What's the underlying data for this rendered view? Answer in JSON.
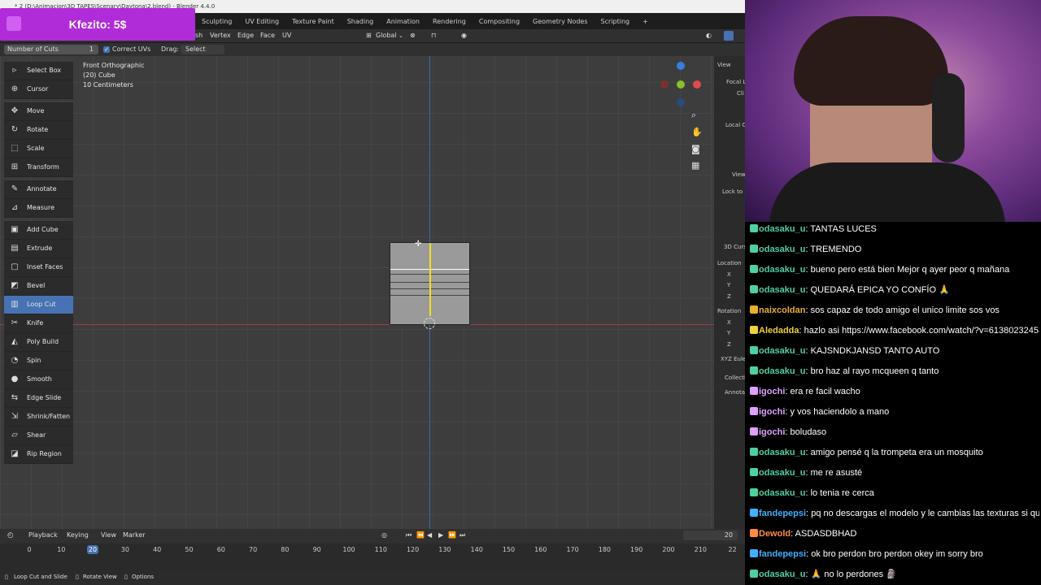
{
  "window": {
    "title": "* 2 (D:\\Animacion\\3D TAPES\\Scenary\\Daytona\\2.blend) - Blender 4.4.0"
  },
  "donation": {
    "text": "Kfezito: 5$"
  },
  "workspace_tabs": [
    "Sculpting",
    "UV Editing",
    "Texture Paint",
    "Shading",
    "Animation",
    "Rendering",
    "Compositing",
    "Geometry Nodes",
    "Scripting",
    "+"
  ],
  "header": {
    "menus": [
      "sh",
      "Vertex",
      "Edge",
      "Face",
      "UV"
    ],
    "orientation": "Global"
  },
  "tool_settings": {
    "cuts_label": "Number of Cuts",
    "cuts_value": "1",
    "correct_uvs_label": "Correct UVs",
    "drag_label": "Drag:",
    "drag_value": "Select Box"
  },
  "viewport_info": {
    "line1": "Front Orthographic",
    "line2": "(20) Cube",
    "line3": "10 Centimeters"
  },
  "tools": [
    {
      "label": "Select Box",
      "icon": "select-box-icon",
      "glyph": "▹"
    },
    {
      "label": "Cursor",
      "icon": "cursor-icon",
      "glyph": "⊕"
    },
    {
      "label": "Move",
      "icon": "move-icon",
      "glyph": "✥"
    },
    {
      "label": "Rotate",
      "icon": "rotate-icon",
      "glyph": "↻"
    },
    {
      "label": "Scale",
      "icon": "scale-icon",
      "glyph": "⬚"
    },
    {
      "label": "Transform",
      "icon": "transform-icon",
      "glyph": "⊞"
    },
    {
      "label": "Annotate",
      "icon": "annotate-icon",
      "glyph": "✎"
    },
    {
      "label": "Measure",
      "icon": "measure-icon",
      "glyph": "⊿"
    },
    {
      "label": "Add Cube",
      "icon": "add-cube-icon",
      "glyph": "▣"
    },
    {
      "label": "Extrude Region",
      "icon": "extrude-region-icon",
      "glyph": "▤"
    },
    {
      "label": "Inset Faces",
      "icon": "inset-faces-icon",
      "glyph": "▢"
    },
    {
      "label": "Bevel",
      "icon": "bevel-icon",
      "glyph": "◩"
    },
    {
      "label": "Loop Cut",
      "icon": "loop-cut-icon",
      "glyph": "▥"
    },
    {
      "label": "Knife",
      "icon": "knife-icon",
      "glyph": "✂"
    },
    {
      "label": "Poly Build",
      "icon": "poly-build-icon",
      "glyph": "◭"
    },
    {
      "label": "Spin",
      "icon": "spin-icon",
      "glyph": "◔"
    },
    {
      "label": "Smooth",
      "icon": "smooth-icon",
      "glyph": "●"
    },
    {
      "label": "Edge Slide",
      "icon": "edge-slide-icon",
      "glyph": "⇆"
    },
    {
      "label": "Shrink/Fatten",
      "icon": "shrink-fatten-icon",
      "glyph": "⇲"
    },
    {
      "label": "Shear",
      "icon": "shear-icon",
      "glyph": "▱"
    },
    {
      "label": "Rip Region",
      "icon": "rip-region-icon",
      "glyph": "◪"
    }
  ],
  "sidebar": {
    "view_header": "View",
    "focal": "Focal L",
    "clip": "Cli",
    "local": "Local C",
    "view2": "View",
    "lock": "Lock to",
    "cursor_header": "3D Curs",
    "location": "Location",
    "x": "X",
    "y": "Y",
    "z": "Z",
    "rotation": "Rotation",
    "rx": "X",
    "ry": "Y",
    "rz": "Z",
    "euler": "XYZ Eule",
    "collection": "Collecti",
    "annotations": "Annotat"
  },
  "timeline": {
    "menus": [
      "Playback",
      "Keying",
      "View",
      "Marker"
    ],
    "current_frame": "20",
    "end_field": "20",
    "ticks": [
      "0",
      "10",
      "20",
      "30",
      "40",
      "50",
      "60",
      "70",
      "80",
      "90",
      "100",
      "110",
      "120",
      "130",
      "140",
      "150",
      "160",
      "170",
      "180",
      "190",
      "200",
      "210",
      "22"
    ]
  },
  "statusbar": {
    "item1": "Loop Cut and Slide",
    "item2": "Rotate View",
    "item3": "Options"
  },
  "chat": [
    {
      "user": "odasaku_u",
      "text": "TANTAS LUCES",
      "color": "#4fd0a0"
    },
    {
      "user": "odasaku_u",
      "text": "TREMENDO",
      "color": "#4fd0a0"
    },
    {
      "user": "odasaku_u",
      "text": "bueno pero está bien Mejor q ayer peor q mañana",
      "color": "#4fd0a0"
    },
    {
      "user": "odasaku_u",
      "text": "QUEDARÁ EPICA YO CONFÍO 🙏",
      "color": "#4fd0a0"
    },
    {
      "user": "naixcoldan",
      "text": "sos capaz de todo amigo el unico limite sos vos",
      "color": "#e8b030"
    },
    {
      "user": "Aledadda",
      "text": "hazlo asi https://www.facebook.com/watch/?v=613802324531895",
      "color": "#f0d040"
    },
    {
      "user": "odasaku_u",
      "text": "KAJSNDKJANSD TANTO AUTO",
      "color": "#4fd0a0"
    },
    {
      "user": "odasaku_u",
      "text": "bro haz al rayo mcqueen q tanto",
      "color": "#4fd0a0"
    },
    {
      "user": "igochi",
      "text": "era re facil wacho",
      "color": "#e0a0ff"
    },
    {
      "user": "igochi",
      "text": "y vos haciendolo a mano",
      "color": "#e0a0ff"
    },
    {
      "user": "igochi",
      "text": "boludaso",
      "color": "#e0a0ff"
    },
    {
      "user": "odasaku_u",
      "text": "amigo pensé q la trompeta era un mosquito",
      "color": "#4fd0a0"
    },
    {
      "user": "odasaku_u",
      "text": "me re asusté",
      "color": "#4fd0a0"
    },
    {
      "user": "odasaku_u",
      "text": "lo tenia re cerca",
      "color": "#4fd0a0"
    },
    {
      "user": "fandepepsi",
      "text": "pq no descargas el modelo y le cambias las texturas si queres",
      "color": "#40b0ff"
    },
    {
      "user": "Dewold",
      "text": "ASDASDBHAD",
      "color": "#ff8c40"
    },
    {
      "user": "fandepepsi",
      "text": "ok bro perdon bro perdon okey im sorry bro",
      "color": "#40b0ff"
    },
    {
      "user": "odasaku_u",
      "text": "🙏 no lo perdones 🗿",
      "color": "#4fd0a0"
    }
  ]
}
